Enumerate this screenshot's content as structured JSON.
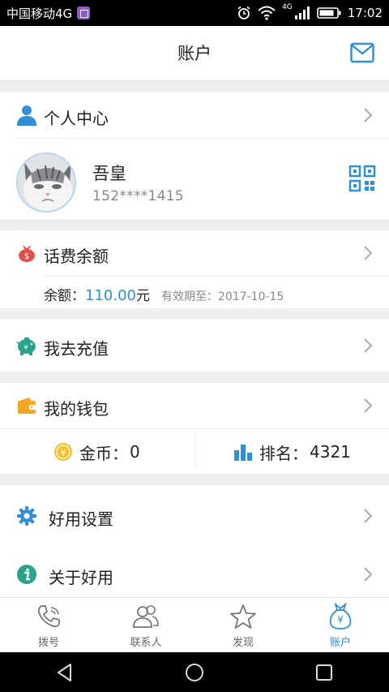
{
  "status_bar": {
    "carrier": "中国移动4G",
    "network": "4G",
    "time": "17:02"
  },
  "header": {
    "title": "账户",
    "mail_icon": "mail-icon"
  },
  "profile": {
    "section_label": "个人中心",
    "name": "吾皇",
    "phone": "152****1415"
  },
  "balance": {
    "section_label": "话费余额",
    "amount_prefix": "余额：",
    "amount": "110.00",
    "amount_unit": "元",
    "expiry_label": "有效期至：",
    "expiry_date": "2017-10-15"
  },
  "recharge": {
    "label": "我去充值"
  },
  "wallet": {
    "label": "我的钱包",
    "coins_label": "金币：",
    "coins_value": "0",
    "rank_label": "排名：",
    "rank_value": "4321"
  },
  "settings": {
    "label": "好用设置"
  },
  "about": {
    "label": "关于好用"
  },
  "tabs": [
    {
      "label": "拨号",
      "icon": "phone-icon"
    },
    {
      "label": "联系人",
      "icon": "contacts-icon"
    },
    {
      "label": "发现",
      "icon": "star-icon"
    },
    {
      "label": "账户",
      "icon": "money-bag-icon"
    }
  ],
  "colors": {
    "accent": "#2f8fd8",
    "coin": "#f3c22b",
    "wallet": "#f5a623",
    "balance_icon": "#e2504a",
    "recharge_icon": "#2ba38a"
  }
}
